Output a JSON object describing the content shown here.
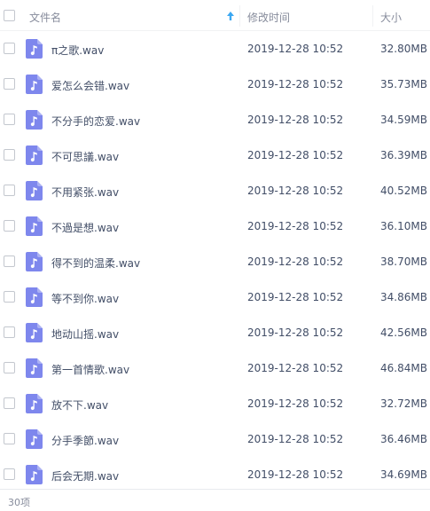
{
  "header": {
    "name_label": "文件名",
    "time_label": "修改时间",
    "size_label": "大小",
    "sort_icon": "sort-up-arrow-icon",
    "accent_color": "#3ba7f1"
  },
  "files": [
    {
      "name": "π之歌.wav",
      "time": "2019-12-28 10:52",
      "size": "32.80MB",
      "icon": "music-file-icon"
    },
    {
      "name": "爱怎么会错.wav",
      "time": "2019-12-28 10:52",
      "size": "35.73MB",
      "icon": "music-file-icon"
    },
    {
      "name": "不分手的恋爱.wav",
      "time": "2019-12-28 10:52",
      "size": "34.59MB",
      "icon": "music-file-icon"
    },
    {
      "name": "不可思議.wav",
      "time": "2019-12-28 10:52",
      "size": "36.39MB",
      "icon": "music-file-icon"
    },
    {
      "name": "不用紧张.wav",
      "time": "2019-12-28 10:52",
      "size": "40.52MB",
      "icon": "music-file-icon"
    },
    {
      "name": "不過是想.wav",
      "time": "2019-12-28 10:52",
      "size": "36.10MB",
      "icon": "music-file-icon"
    },
    {
      "name": "得不到的温柔.wav",
      "time": "2019-12-28 10:52",
      "size": "38.70MB",
      "icon": "music-file-icon"
    },
    {
      "name": "等不到你.wav",
      "time": "2019-12-28 10:52",
      "size": "34.86MB",
      "icon": "music-file-icon"
    },
    {
      "name": "地动山摇.wav",
      "time": "2019-12-28 10:52",
      "size": "42.56MB",
      "icon": "music-file-icon"
    },
    {
      "name": "第一首情歌.wav",
      "time": "2019-12-28 10:52",
      "size": "46.84MB",
      "icon": "music-file-icon"
    },
    {
      "name": "放不下.wav",
      "time": "2019-12-28 10:52",
      "size": "32.72MB",
      "icon": "music-file-icon"
    },
    {
      "name": "分手季節.wav",
      "time": "2019-12-28 10:52",
      "size": "36.46MB",
      "icon": "music-file-icon"
    },
    {
      "name": "后会无期.wav",
      "time": "2019-12-28 10:52",
      "size": "34.69MB",
      "icon": "music-file-icon"
    }
  ],
  "footer": {
    "count_label": "30项"
  },
  "colors": {
    "file_icon": "#7e87ed",
    "text": "#424e67",
    "muted_text": "#878c9c"
  }
}
